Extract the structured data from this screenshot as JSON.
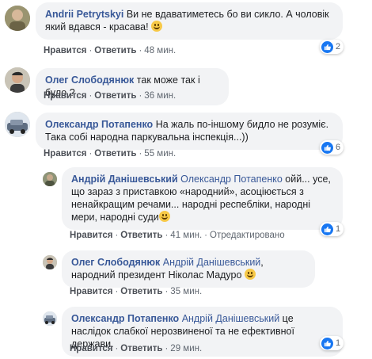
{
  "colors": {
    "link": "#385898",
    "bubble": "#f2f3f5",
    "like": "#1877f2"
  },
  "actions": {
    "like": "Нравится",
    "reply": "Ответить",
    "edited": "Отредактировано"
  },
  "comments": [
    {
      "author": "Andrii Petrytskyi",
      "text": "Ви не вдаватиметесь бо ви сикло. А чоловік який вдався - красава!",
      "emoji": "grinning-face",
      "time": "48 мин.",
      "likes": "2"
    },
    {
      "author": "Олег Слободянюк",
      "text": "так може так і було ?",
      "time": "36 мин."
    },
    {
      "author": "Олександр Потапенко",
      "text": "На жаль по-іншому бидло не розуміє. Така собі народна паркувальна інспекція...))",
      "time": "55 мин.",
      "likes": "6"
    },
    {
      "author": "Андрій Данішевський",
      "mention": "Олександр Потапенко",
      "text": "ойй... усе, що зараз з приставкою «народний», асоціюється з ненайкращим речами... народні респебліки, народні мери, народні суди",
      "emoji": "smirking-face",
      "time": "41 мин.",
      "likes": "1"
    },
    {
      "author": "Олег Слободянюк",
      "mention": "Андрій Данішевський",
      "text": ", народний президент Ніколас Мадуро",
      "emoji": "smiling-face",
      "time": "35 мин."
    },
    {
      "author": "Олександр Потапенко",
      "mention": "Андрій Данішевський",
      "text": "це наслідок слабкої нерозвиненої та не ефективної держави.",
      "time": "29 мин.",
      "likes": "1"
    }
  ]
}
